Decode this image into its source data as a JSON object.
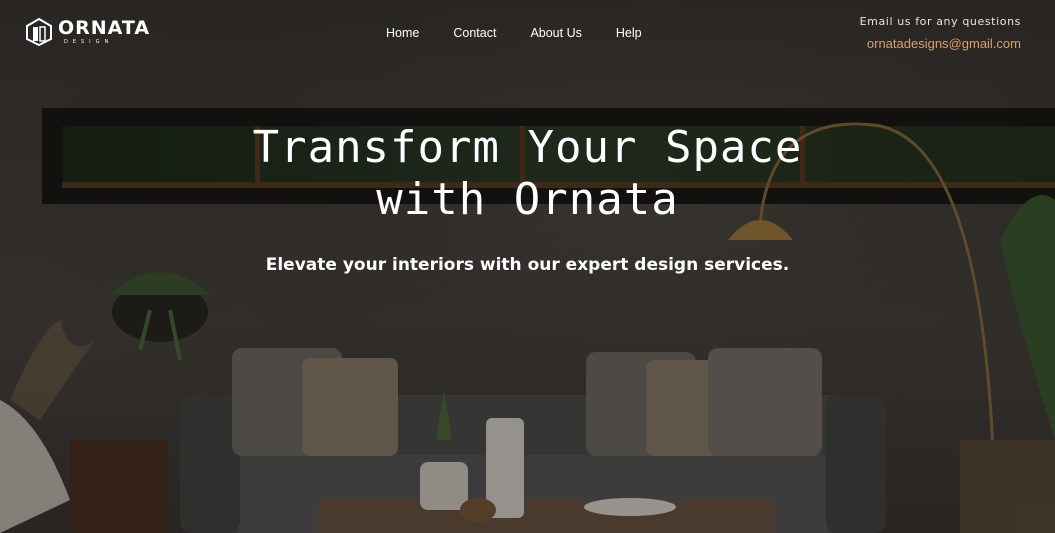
{
  "brand": {
    "name": "ORNATA",
    "tagline": "DESIGN"
  },
  "nav": {
    "items": [
      {
        "label": "Home"
      },
      {
        "label": "Contact"
      },
      {
        "label": "About Us"
      },
      {
        "label": "Help"
      }
    ]
  },
  "contact": {
    "label": "Email us for any questions",
    "email": "ornatadesigns@gmail.com"
  },
  "hero": {
    "headline_line1": "Transform Your Space",
    "headline_line2": "with Ornata",
    "subheadline": "Elevate your interiors with our expert design services."
  },
  "colors": {
    "accent": "#d8a06a",
    "text": "#ffffff"
  },
  "icons": {
    "logo": "hexagon-building-logo"
  }
}
